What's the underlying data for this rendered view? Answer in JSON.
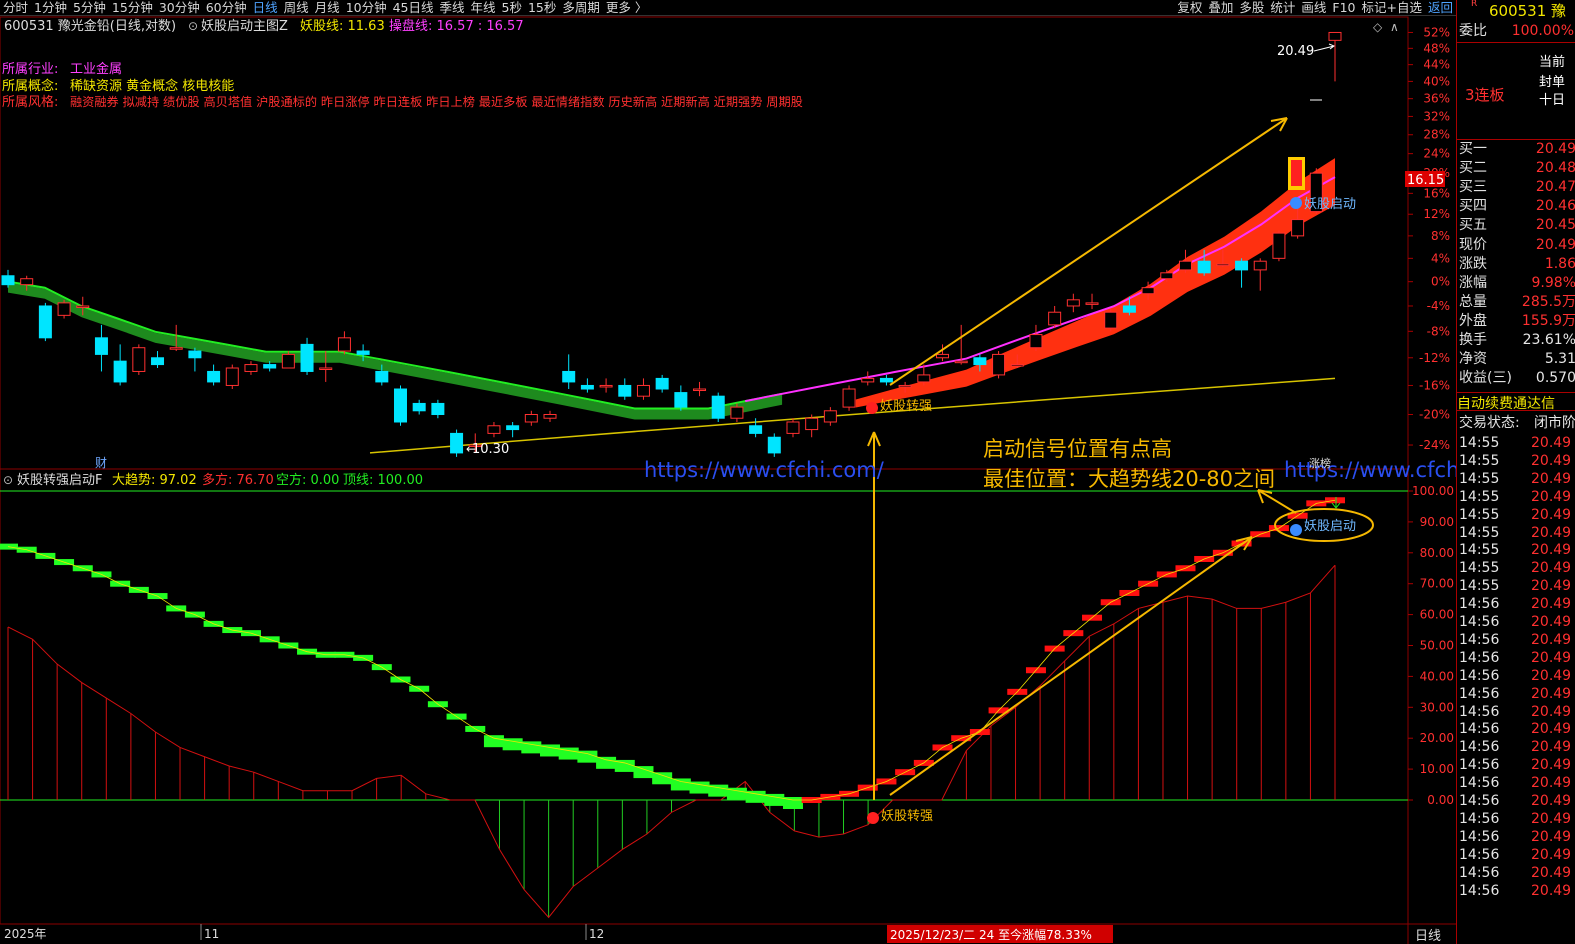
{
  "toolbar": {
    "periods": [
      "分时",
      "1分钟",
      "5分钟",
      "15分钟",
      "30分钟",
      "60分钟",
      "日线",
      "周线",
      "月线",
      "10分钟",
      "45日线",
      "季线",
      "年线",
      "5秒",
      "15秒",
      "多周期",
      "更多 〉"
    ],
    "active_period": "日线",
    "tools": [
      "复权",
      "叠加",
      "多股",
      "统计",
      "画线",
      "F10",
      "标记+自选",
      "返回"
    ]
  },
  "main_header": {
    "stock_line": "600531 豫光金铅(日线,对数)",
    "indicator_name": "妖股启动主图Z",
    "yaoguxian_label": "妖股线: 11.63",
    "caopan_label": "操盘线: 16.57 : 16.57"
  },
  "info": {
    "industry_label": "所属行业:",
    "industry_value": "工业金属",
    "concept_label": "所属概念:",
    "concept_value": "稀缺资源 黄金概念 核电核能",
    "style_label": "所属风格:",
    "style_value": "融资融券 拟减持 绩优股 高贝塔值 沪股通标的 昨日涨停 昨日连板 昨日上榜 最近多板 最近情绪指数 历史新高 近期新高 近期强势 周期股"
  },
  "main_axis": {
    "percent_ticks": [
      "52%",
      "48%",
      "44%",
      "40%",
      "36%",
      "32%",
      "28%",
      "24%",
      "20%",
      "16%",
      "12%",
      "8%",
      "4%",
      "0%",
      "-4%",
      "-8%",
      "-12%",
      "-16%",
      "-20%",
      "-24%"
    ],
    "price_marker": "16.15"
  },
  "annotations": {
    "high_label": "20.49",
    "low_label": "10.30",
    "cai_mark": "财",
    "zhangbang_mark": "涨榜",
    "signal_zhuanqiang": "妖股转强",
    "signal_qidong": "妖股启动",
    "note_line1": "启动信号位置有点高",
    "note_line2": "最佳位置：大趋势线20-80之间",
    "watermark": "https://www.cfchi.com/",
    "watermark_right": "https://www.cfchi.com/"
  },
  "sub_header": {
    "indicator_name": "妖股转强启动F",
    "trend_label": "大趋势: 97.02",
    "bull_label": "多方: 76.70",
    "bear_label": "空方: 0.00",
    "top_label": "顶线: 100.00"
  },
  "sub_axis": {
    "ticks": [
      "100.00",
      "90.00",
      "80.00",
      "70.00",
      "60.00",
      "50.00",
      "40.00",
      "30.00",
      "20.00",
      "10.00",
      "0.00"
    ]
  },
  "bottom_bar": {
    "labels": [
      "2025年",
      "11",
      "12"
    ],
    "range_text": "2025/12/23/二 24 至今涨幅78.33%",
    "period_btn": "日线"
  },
  "quote": {
    "code_line": "600531 豫",
    "weibi_label": "委比",
    "weibi_value": "100.00%",
    "status_line1": "当前",
    "status_line2": "封单",
    "status_line3": "十日",
    "lianban": "3连板",
    "bids": [
      {
        "label": "买一",
        "value": "20.49"
      },
      {
        "label": "买二",
        "value": "20.48"
      },
      {
        "label": "买三",
        "value": "20.47"
      },
      {
        "label": "买四",
        "value": "20.46"
      },
      {
        "label": "买五",
        "value": "20.45"
      }
    ],
    "stats": [
      {
        "label": "现价",
        "value": "20.49",
        "color": "red"
      },
      {
        "label": "涨跌",
        "value": "1.86",
        "color": "red"
      },
      {
        "label": "涨幅",
        "value": "9.98%",
        "color": "red"
      },
      {
        "label": "总量",
        "value": "285.5万",
        "color": "red"
      },
      {
        "label": "外盘",
        "value": "155.9万",
        "color": "red"
      },
      {
        "label": "换手",
        "value": "23.61%",
        "color": "white"
      },
      {
        "label": "净资",
        "value": "5.31",
        "color": "white"
      },
      {
        "label": "收益(三)",
        "value": "0.570",
        "color": "white"
      }
    ],
    "auto_renew": "自动续费通达信",
    "trade_state_label": "交易状态:",
    "trade_state_value": "闭市阶",
    "ticks": [
      {
        "time": "14:55",
        "price": "20.49"
      },
      {
        "time": "14:55",
        "price": "20.49"
      },
      {
        "time": "14:55",
        "price": "20.49"
      },
      {
        "time": "14:55",
        "price": "20.49"
      },
      {
        "time": "14:55",
        "price": "20.49"
      },
      {
        "time": "14:55",
        "price": "20.49"
      },
      {
        "time": "14:55",
        "price": "20.49"
      },
      {
        "time": "14:55",
        "price": "20.49"
      },
      {
        "time": "14:55",
        "price": "20.49"
      },
      {
        "time": "14:56",
        "price": "20.49"
      },
      {
        "time": "14:56",
        "price": "20.49"
      },
      {
        "time": "14:56",
        "price": "20.49"
      },
      {
        "time": "14:56",
        "price": "20.49"
      },
      {
        "time": "14:56",
        "price": "20.49"
      },
      {
        "time": "14:56",
        "price": "20.49"
      },
      {
        "time": "14:56",
        "price": "20.49"
      },
      {
        "time": "14:56",
        "price": "20.49"
      },
      {
        "time": "14:56",
        "price": "20.49"
      },
      {
        "time": "14:56",
        "price": "20.49"
      },
      {
        "time": "14:56",
        "price": "20.49"
      },
      {
        "time": "14:56",
        "price": "20.49"
      },
      {
        "time": "14:56",
        "price": "20.49"
      },
      {
        "time": "14:56",
        "price": "20.49"
      },
      {
        "time": "14:56",
        "price": "20.49"
      },
      {
        "time": "14:56",
        "price": "20.49"
      },
      {
        "time": "14:56",
        "price": "20.49"
      }
    ]
  },
  "chart_data": [
    {
      "type": "candlestick",
      "note_ref": "main",
      "y_scale": "percent change",
      "ylim": [
        -26,
        54
      ],
      "candles": [
        {
          "o": 1.0,
          "c": -0.5,
          "h": 2.0,
          "l": -1.0
        },
        {
          "o": -0.5,
          "c": 0.5,
          "h": 1.0,
          "l": -1.5
        },
        {
          "o": -4.0,
          "c": -9.0,
          "h": -3.5,
          "l": -9.5
        },
        {
          "o": -5.5,
          "c": -3.5,
          "h": -3.0,
          "l": -6.0
        },
        {
          "o": -4.0,
          "c": -4.0,
          "h": -2.5,
          "l": -5.5
        },
        {
          "o": -9.0,
          "c": -11.5,
          "h": -7.0,
          "l": -14.0
        },
        {
          "o": -12.5,
          "c": -15.5,
          "h": -10.0,
          "l": -16.0
        },
        {
          "o": -14.0,
          "c": -10.5,
          "h": -10.0,
          "l": -14.5
        },
        {
          "o": -12.0,
          "c": -13.0,
          "h": -11.0,
          "l": -13.5
        },
        {
          "o": -10.5,
          "c": -10.5,
          "h": -7.0,
          "l": -11.0
        },
        {
          "o": -11.0,
          "c": -12.0,
          "h": -10.5,
          "l": -14.0
        },
        {
          "o": -14.0,
          "c": -15.5,
          "h": -13.0,
          "l": -16.0
        },
        {
          "o": -16.0,
          "c": -13.5,
          "h": -13.0,
          "l": -16.5
        },
        {
          "o": -14.0,
          "c": -13.0,
          "h": -12.5,
          "l": -14.5
        },
        {
          "o": -13.0,
          "c": -13.5,
          "h": -12.5,
          "l": -14.0
        },
        {
          "o": -13.5,
          "c": -11.5,
          "h": -11.0,
          "l": -13.5
        },
        {
          "o": -10.0,
          "c": -14.0,
          "h": -9.0,
          "l": -14.5
        },
        {
          "o": -13.5,
          "c": -13.5,
          "h": -11.0,
          "l": -15.5
        },
        {
          "o": -11.0,
          "c": -9.0,
          "h": -8.0,
          "l": -11.5
        },
        {
          "o": -11.0,
          "c": -11.5,
          "h": -10.0,
          "l": -12.5
        },
        {
          "o": -14.0,
          "c": -15.5,
          "h": -13.0,
          "l": -16.0
        },
        {
          "o": -16.5,
          "c": -21.0,
          "h": -16.0,
          "l": -21.5
        },
        {
          "o": -18.5,
          "c": -19.5,
          "h": -18.0,
          "l": -20.0
        },
        {
          "o": -18.5,
          "c": -20.0,
          "h": -18.0,
          "l": -20.5
        },
        {
          "o": -22.5,
          "c": -25.0,
          "h": -22.0,
          "l": -25.5
        },
        {
          "o": -24.0,
          "c": -24.0,
          "h": -22.5,
          "l": -25.0
        },
        {
          "o": -22.5,
          "c": -21.5,
          "h": -21.0,
          "l": -23.0
        },
        {
          "o": -21.5,
          "c": -22.0,
          "h": -21.0,
          "l": -23.0
        },
        {
          "o": -21.0,
          "c": -20.0,
          "h": -19.5,
          "l": -21.5
        },
        {
          "o": -20.5,
          "c": -20.0,
          "h": -19.5,
          "l": -21.0
        },
        {
          "o": -14.0,
          "c": -15.5,
          "h": -11.5,
          "l": -16.5
        },
        {
          "o": -16.0,
          "c": -16.5,
          "h": -15.0,
          "l": -17.0
        },
        {
          "o": -16.0,
          "c": -16.0,
          "h": -15.0,
          "l": -17.0
        },
        {
          "o": -16.0,
          "c": -17.5,
          "h": -15.0,
          "l": -18.0
        },
        {
          "o": -17.5,
          "c": -16.0,
          "h": -15.0,
          "l": -18.0
        },
        {
          "o": -15.0,
          "c": -16.5,
          "h": -14.5,
          "l": -17.0
        },
        {
          "o": -17.0,
          "c": -19.0,
          "h": -16.0,
          "l": -19.5
        },
        {
          "o": -16.5,
          "c": -16.5,
          "h": -15.5,
          "l": -17.5
        },
        {
          "o": -17.5,
          "c": -20.5,
          "h": -17.0,
          "l": -21.0
        },
        {
          "o": -20.5,
          "c": -19.0,
          "h": -18.5,
          "l": -21.0
        },
        {
          "o": -21.5,
          "c": -22.5,
          "h": -20.5,
          "l": -23.0
        },
        {
          "o": -23.0,
          "c": -25.0,
          "h": -22.5,
          "l": -25.5
        },
        {
          "o": -22.5,
          "c": -21.0,
          "h": -20.5,
          "l": -23.0
        },
        {
          "o": -22.0,
          "c": -20.5,
          "h": -20.0,
          "l": -23.0
        },
        {
          "o": -21.0,
          "c": -19.5,
          "h": -19.0,
          "l": -21.5
        },
        {
          "o": -19.0,
          "c": -16.5,
          "h": -16.0,
          "l": -19.5
        },
        {
          "o": -15.5,
          "c": -15.0,
          "h": -14.0,
          "l": -16.0
        },
        {
          "o": -15.0,
          "c": -15.5,
          "h": -14.5,
          "l": -16.0
        },
        {
          "o": -16.0,
          "c": -16.0,
          "h": -15.5,
          "l": -17.0
        },
        {
          "o": -15.5,
          "c": -14.5,
          "h": -13.0,
          "l": -16.0
        },
        {
          "o": -12.0,
          "c": -11.5,
          "h": -10.0,
          "l": -12.5
        },
        {
          "o": -12.5,
          "c": -12.5,
          "h": -7.0,
          "l": -13.0
        },
        {
          "o": -12.0,
          "c": -13.0,
          "h": -11.5,
          "l": -14.0
        },
        {
          "o": -14.5,
          "c": -11.5,
          "h": -11.0,
          "l": -15.0
        },
        {
          "o": -13.0,
          "c": -13.0,
          "h": -11.5,
          "l": -13.5
        },
        {
          "o": -10.5,
          "c": -8.5,
          "h": -7.0,
          "l": -11.0
        },
        {
          "o": -7.0,
          "c": -5.0,
          "h": -4.0,
          "l": -7.5
        },
        {
          "o": -4.0,
          "c": -3.0,
          "h": -2.0,
          "l": -5.0
        },
        {
          "o": -3.5,
          "c": -3.5,
          "h": -2.0,
          "l": -4.5
        },
        {
          "o": -7.5,
          "c": -5.0,
          "h": -4.5,
          "l": -8.0
        },
        {
          "o": -4.0,
          "c": -5.0,
          "h": -2.5,
          "l": -5.5
        },
        {
          "o": -2.0,
          "c": -1.0,
          "h": 0.0,
          "l": -3.0
        },
        {
          "o": 0.5,
          "c": 1.5,
          "h": 2.0,
          "l": 0.0
        },
        {
          "o": 2.0,
          "c": 3.5,
          "h": 5.5,
          "l": 1.5
        },
        {
          "o": 3.5,
          "c": 1.5,
          "h": 5.5,
          "l": 1.0
        },
        {
          "o": 3.0,
          "c": 3.0,
          "h": 5.5,
          "l": 2.5
        },
        {
          "o": 3.5,
          "c": 2.0,
          "h": 4.0,
          "l": -1.0
        },
        {
          "o": 2.0,
          "c": 3.5,
          "h": 4.0,
          "l": -1.5
        },
        {
          "o": 4.0,
          "c": 8.5,
          "h": 9.0,
          "l": 3.5
        },
        {
          "o": 8.0,
          "c": 11.0,
          "h": 14.5,
          "l": 7.5
        },
        {
          "o": 12.5,
          "c": 20.0,
          "h": 21.0,
          "l": 12.0
        },
        {
          "o": 50.0,
          "c": 52.0,
          "h": 52.0,
          "l": 40.0
        }
      ],
      "ma_lines": [
        {
          "name": "操盘线",
          "values": [
            -1,
            -2,
            -5,
            -7,
            -9,
            -10,
            -11,
            -12,
            -12,
            -12,
            -13,
            -14,
            -15,
            -16,
            -17,
            -18,
            -19,
            -20,
            -20,
            -20,
            -19,
            -18,
            -17,
            -16,
            -15,
            -14,
            -13,
            -11,
            -9,
            -7,
            -5,
            -2,
            2,
            5,
            9,
            14,
            18
          ]
        },
        {
          "name": "妖股线",
          "values": [
            -25,
            -24,
            -23,
            -22,
            -21,
            -20,
            -19,
            -18,
            -17,
            -16,
            -15
          ]
        }
      ]
    },
    {
      "type": "bar",
      "note_ref": "sub",
      "title": "妖股转强启动F",
      "ylim": [
        -45,
        100
      ],
      "series": [
        {
          "name": "大趋势",
          "values": [
            82,
            81,
            79,
            77,
            75,
            73,
            70,
            68,
            66,
            62,
            60,
            57,
            55,
            54,
            52,
            50,
            48,
            47,
            47,
            46,
            43,
            39,
            36,
            31,
            27,
            23,
            20,
            19,
            18,
            17,
            16,
            15,
            13,
            12,
            10,
            8,
            6,
            5,
            4,
            3,
            2,
            1,
            0,
            0,
            1,
            2,
            4,
            6,
            9,
            12,
            17,
            20,
            22,
            29,
            35,
            42,
            49,
            54,
            59,
            64,
            67,
            70,
            73,
            75,
            78,
            80,
            83,
            86,
            88,
            92,
            96,
            97
          ]
        },
        {
          "name": "多方",
          "values": [
            56,
            52,
            44,
            38,
            33,
            28,
            22,
            17,
            14,
            11,
            9,
            6,
            3,
            3,
            3,
            7,
            8,
            2,
            0,
            0,
            -16,
            -29,
            -38,
            -28,
            -22,
            -16,
            -11,
            -4,
            0,
            0,
            6,
            -4,
            -10,
            -12,
            -11,
            -8,
            0,
            0,
            0,
            16,
            24,
            30,
            37,
            45,
            53,
            57,
            62,
            64,
            66,
            65,
            62,
            62,
            64,
            67,
            76
          ]
        }
      ],
      "reference_lines": [
        {
          "name": "顶线",
          "value": 100
        }
      ]
    }
  ]
}
